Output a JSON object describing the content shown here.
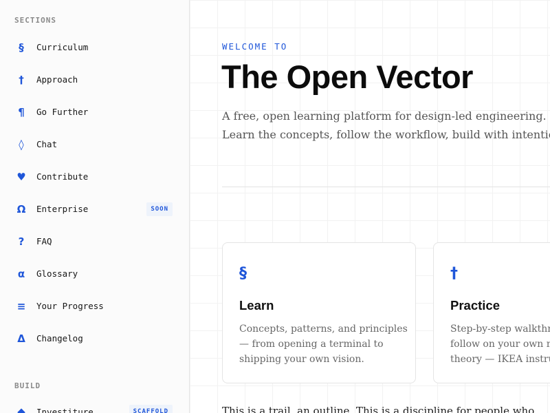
{
  "sidebar": {
    "sections_heading": "SECTIONS",
    "items": [
      {
        "icon": "§",
        "label": "Curriculum"
      },
      {
        "icon": "†",
        "label": "Approach"
      },
      {
        "icon": "¶",
        "label": "Go Further"
      },
      {
        "icon": "◊",
        "label": "Chat"
      },
      {
        "icon": "♥",
        "label": "Contribute"
      },
      {
        "icon": "Ω",
        "label": "Enterprise",
        "badge": "SOON"
      },
      {
        "icon": "?",
        "label": "FAQ"
      },
      {
        "icon": "α",
        "label": "Glossary"
      },
      {
        "icon": "≡",
        "label": "Your Progress"
      },
      {
        "icon": "Δ",
        "label": "Changelog"
      }
    ],
    "build_heading": "BUILD",
    "build_items": [
      {
        "icon": "◆",
        "label": "Investiture",
        "badge": "SCAFFOLD"
      }
    ]
  },
  "main": {
    "eyebrow": "WELCOME TO",
    "title": "The Open Vector",
    "lede": "A free, open learning platform for design-led engineering. Learn the concepts, follow the workflow, build with intention.",
    "cards": [
      {
        "icon": "§",
        "title": "Learn",
        "description": "Concepts, patterns, and principles — from opening a terminal to shipping your own vision."
      },
      {
        "icon": "†",
        "title": "Practice",
        "description": "Step-by-step walkthroughs you follow on your own machine, theory — IKEA instructions"
      }
    ],
    "below_text": "This is a trail, an outline. This is a discipline for people who"
  },
  "colors": {
    "accent": "#1f56d9",
    "sidebar_bg": "#fbfbfb",
    "text_muted": "#666666"
  }
}
